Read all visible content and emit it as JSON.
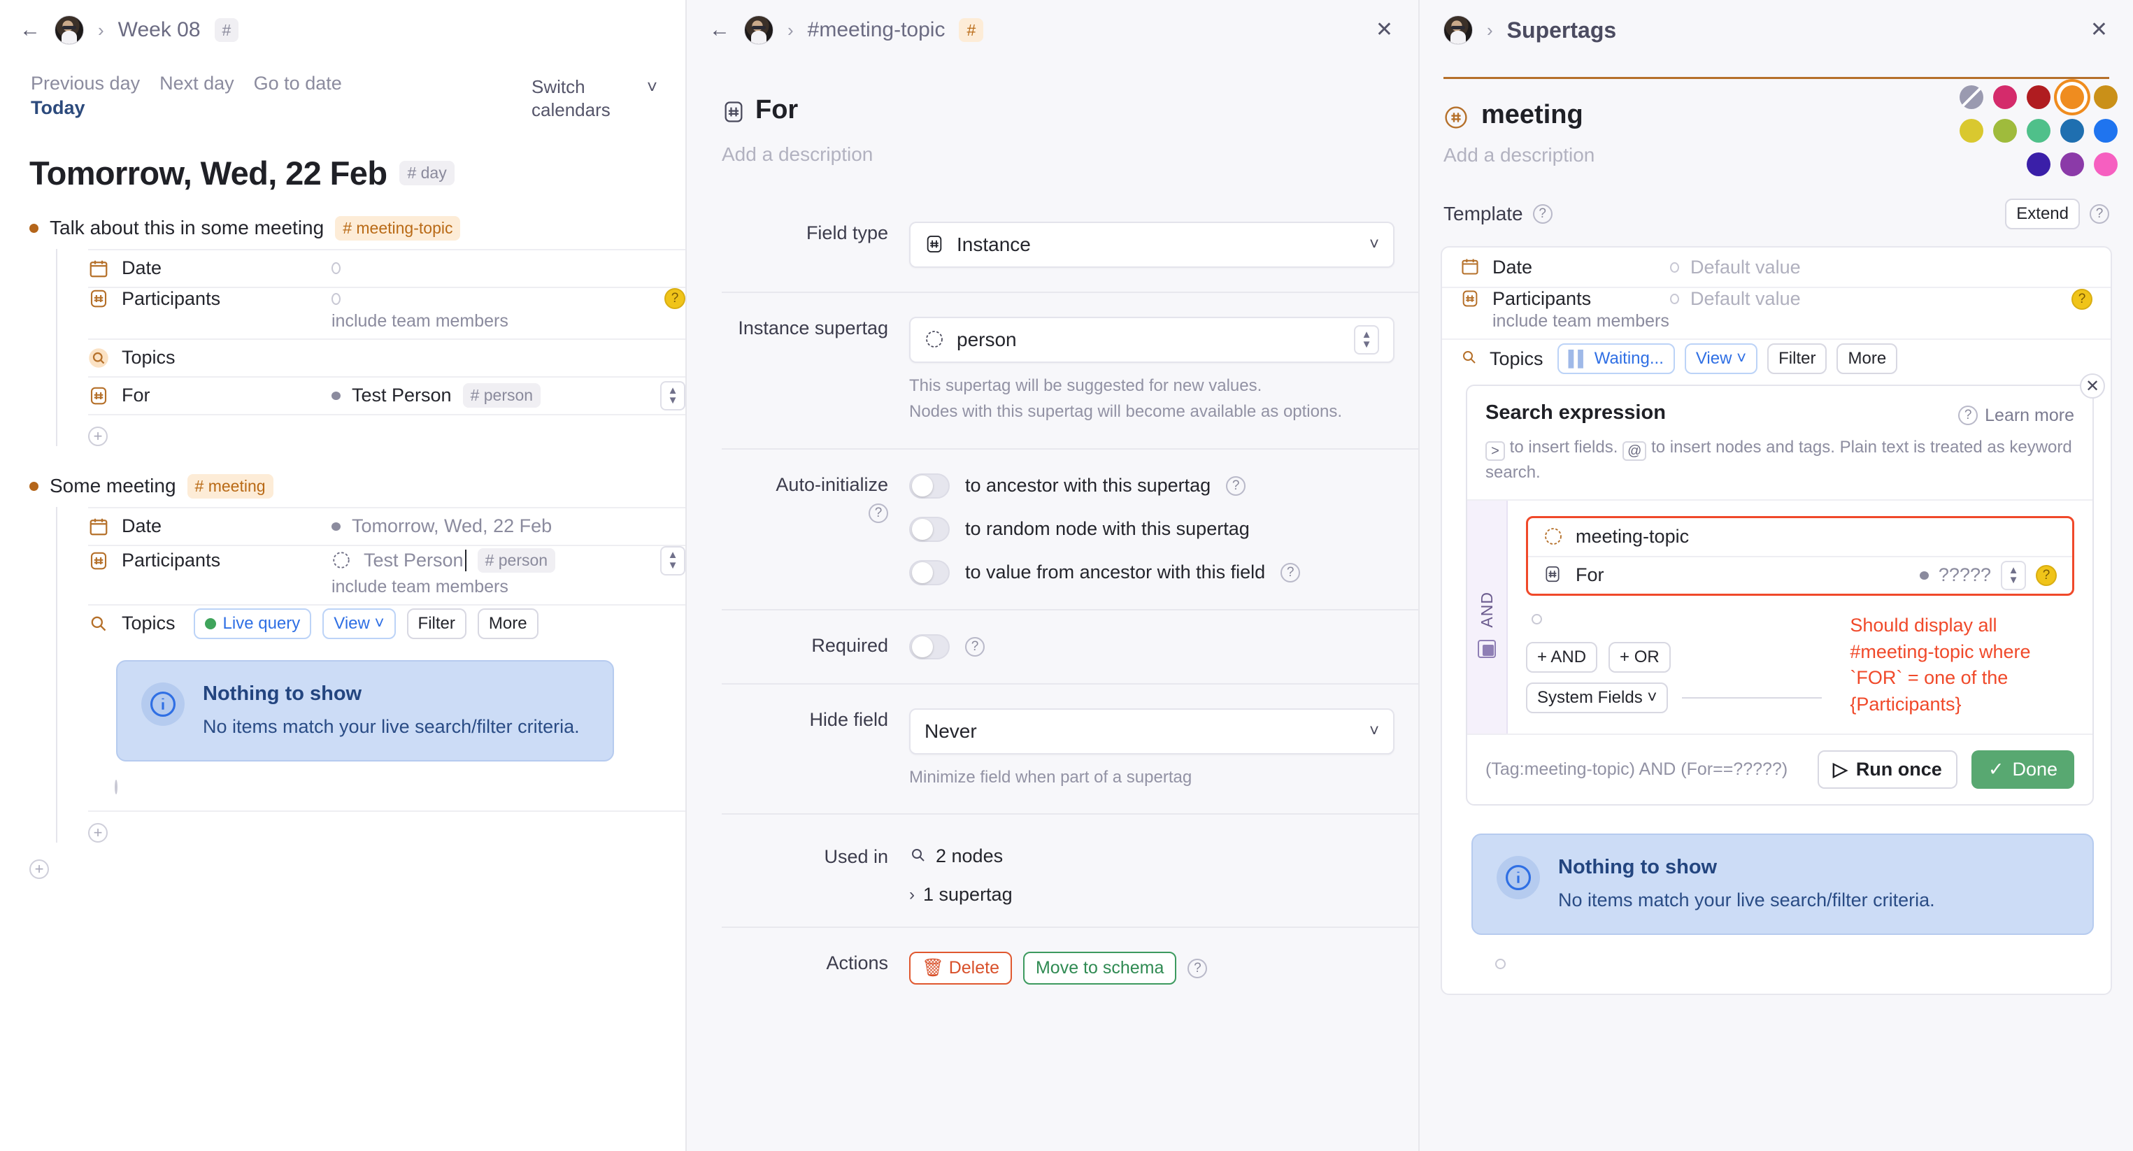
{
  "left": {
    "breadcrumb": {
      "workspace_icon": "avatar",
      "title": "Week 08",
      "tag": "#"
    },
    "nav": {
      "previous_day": "Previous day",
      "next_day": "Next day",
      "go_to_date": "Go to date",
      "today": "Today"
    },
    "switch_calendars": "Switch calendars",
    "date_heading": "Tomorrow, Wed, 22 Feb",
    "date_tag": "# day",
    "nodes": [
      {
        "title": "Talk about this in some meeting",
        "tag": "# meeting-topic",
        "fields": [
          {
            "name": "Date",
            "icon": "calendar-icon",
            "value": "",
            "value_marker": "ring"
          },
          {
            "name": "Participants",
            "icon": "hash-icon",
            "value": "",
            "value_marker": "ring",
            "note": "include team members",
            "help": "?"
          },
          {
            "name": "Topics",
            "icon": "search-icon",
            "value": ""
          },
          {
            "name": "For",
            "icon": "hash-icon",
            "value": "Test Person",
            "value_tag": "# person",
            "value_marker": "dot",
            "stepper": true
          }
        ]
      },
      {
        "title": "Some meeting",
        "tag": "# meeting",
        "fields": [
          {
            "name": "Date",
            "icon": "calendar-icon",
            "value": "Tomorrow, Wed, 22 Feb",
            "value_marker": "dot"
          },
          {
            "name": "Participants",
            "icon": "hash-icon",
            "value": "Test Person",
            "value_tag": "# person",
            "value_marker": "target",
            "note": "include team members",
            "stepper": true
          }
        ],
        "topics": {
          "label": "Topics",
          "live_query": "Live query",
          "view": "View",
          "filter": "Filter",
          "more": "More"
        },
        "empty_state": {
          "title": "Nothing to show",
          "subtitle": "No items match your live search/filter criteria."
        }
      }
    ]
  },
  "middle": {
    "breadcrumb": {
      "title": "#meeting-topic",
      "tag": "#"
    },
    "title": "For",
    "title_icon": "hash-icon",
    "description_placeholder": "Add a description",
    "settings": {
      "field_type": {
        "label": "Field type",
        "value": "Instance",
        "icon": "hash-icon"
      },
      "instance_supertag": {
        "label": "Instance supertag",
        "value": "person",
        "icon": "dashed-hash-icon",
        "hint_line1": "This supertag will be suggested for new values.",
        "hint_line2": "Nodes with this supertag will become available as options."
      },
      "auto_initialize": {
        "label": "Auto-initialize",
        "options": [
          {
            "label": "to ancestor with this supertag",
            "on": false,
            "help": true
          },
          {
            "label": "to random node with this supertag",
            "on": false,
            "help": false
          },
          {
            "label": "to value from ancestor with this field",
            "on": false,
            "help": true
          }
        ]
      },
      "required": {
        "label": "Required",
        "on": false,
        "help": true
      },
      "hide_field": {
        "label": "Hide field",
        "value": "Never",
        "hint": "Minimize field when part of a supertag"
      },
      "used_in": {
        "label": "Used in",
        "nodes": "2 nodes",
        "supertags": "1 supertag"
      },
      "actions": {
        "label": "Actions",
        "delete": "Delete",
        "move_to_schema": "Move to schema"
      }
    }
  },
  "right": {
    "breadcrumb": {
      "title": "Supertags"
    },
    "tag_name": "meeting",
    "tag_icon": "circled-hash-icon",
    "description_placeholder": "Add a description",
    "accent_color": "#ef8c1f",
    "swatches": [
      "#8f8fa5",
      "#d42b6b",
      "#b01c20",
      "#ef8c1f",
      "#ca9018",
      "#d9c82f",
      "#9fbb3c",
      "#4fc08a",
      "#1f6fb0",
      "#1f74ef",
      "#3a1fa8",
      "#8b3aa8",
      "#f65fc0"
    ],
    "selected_swatch_index": 3,
    "template": {
      "label": "Template",
      "extend": "Extend",
      "rows": [
        {
          "name": "Date",
          "icon": "calendar-icon",
          "value": "Default value"
        },
        {
          "name": "Participants",
          "icon": "hash-icon",
          "value": "Default value",
          "note": "include team members",
          "help": "?"
        }
      ],
      "topics": {
        "label": "Topics",
        "status": "Waiting...",
        "view": "View",
        "filter": "Filter",
        "more": "More"
      }
    },
    "query_editor": {
      "title": "Search expression",
      "learn_more": "Learn more",
      "hint_prefix_1": ">",
      "hint_text_1": "to insert fields.",
      "hint_prefix_2": "@",
      "hint_text_2": "to insert nodes and tags. Plain text is treated as keyword search.",
      "rail_label": "AND",
      "node_tag": "meeting-topic",
      "node_field": "For",
      "node_value": "?????",
      "annotation": "Should display all #meeting-topic where `FOR` = one of the {Participants}",
      "add_and": "+ AND",
      "add_or": "+ OR",
      "system_fields": "System Fields",
      "expression": "(Tag:meeting-topic) AND (For==?????)",
      "run_once": "Run once",
      "done": "Done"
    },
    "empty_state": {
      "title": "Nothing to show",
      "subtitle": "No items match your live search/filter criteria."
    }
  }
}
